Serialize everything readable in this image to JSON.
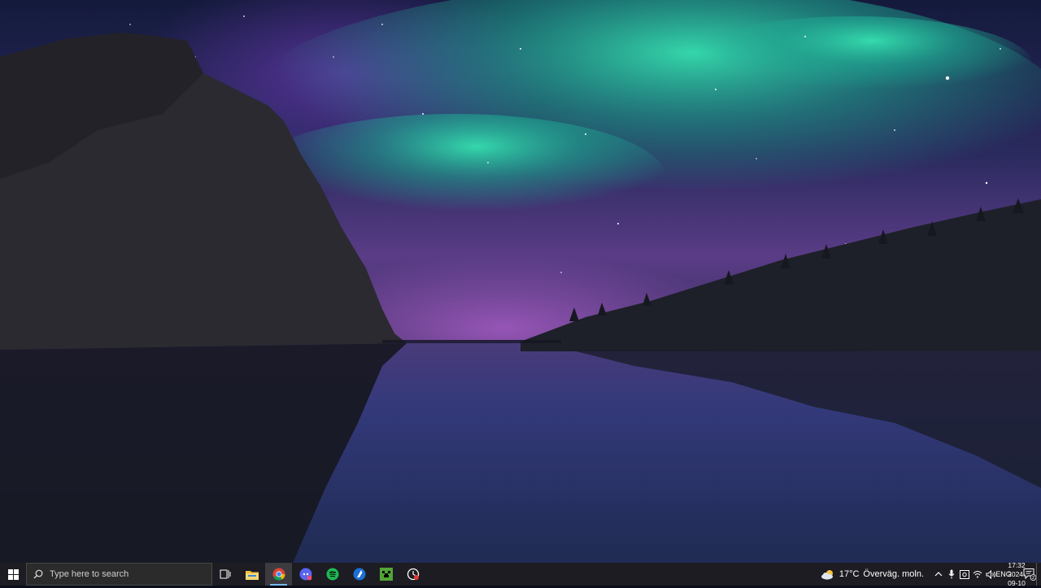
{
  "desktop": {
    "wallpaper": "aurora-lake-night",
    "colors": {
      "sky_top": "#101433",
      "aurora_green": "#2fd1a4",
      "aurora_purple": "#8a4fb0",
      "water": "#2c3568"
    }
  },
  "taskbar": {
    "start": {
      "icon": "windows-logo-icon"
    },
    "search": {
      "placeholder": "Type here to search",
      "value": ""
    },
    "pinned": [
      {
        "name": "task-view",
        "icon": "task-view-icon"
      },
      {
        "name": "file-explorer",
        "icon": "folder-icon"
      },
      {
        "name": "chrome",
        "icon": "chrome-icon",
        "active": true
      },
      {
        "name": "discord",
        "icon": "discord-icon"
      },
      {
        "name": "spotify",
        "icon": "spotify-icon"
      },
      {
        "name": "launcher",
        "icon": "launcher-icon"
      },
      {
        "name": "minecraft",
        "icon": "minecraft-icon"
      },
      {
        "name": "recorder",
        "icon": "recorder-icon"
      }
    ],
    "weather": {
      "temp": "17°C",
      "desc": "Överväg. moln.",
      "icon": "cloudy-icon"
    },
    "tray": [
      "chevron-up-icon",
      "microphone-icon",
      "camera-icon",
      "wifi-icon",
      "volume-icon"
    ],
    "language": "ENG",
    "clock": {
      "time": "17:32",
      "date": "2024-09-10"
    },
    "notifications": {
      "count": "2"
    },
    "accent": "#76b9ed"
  }
}
